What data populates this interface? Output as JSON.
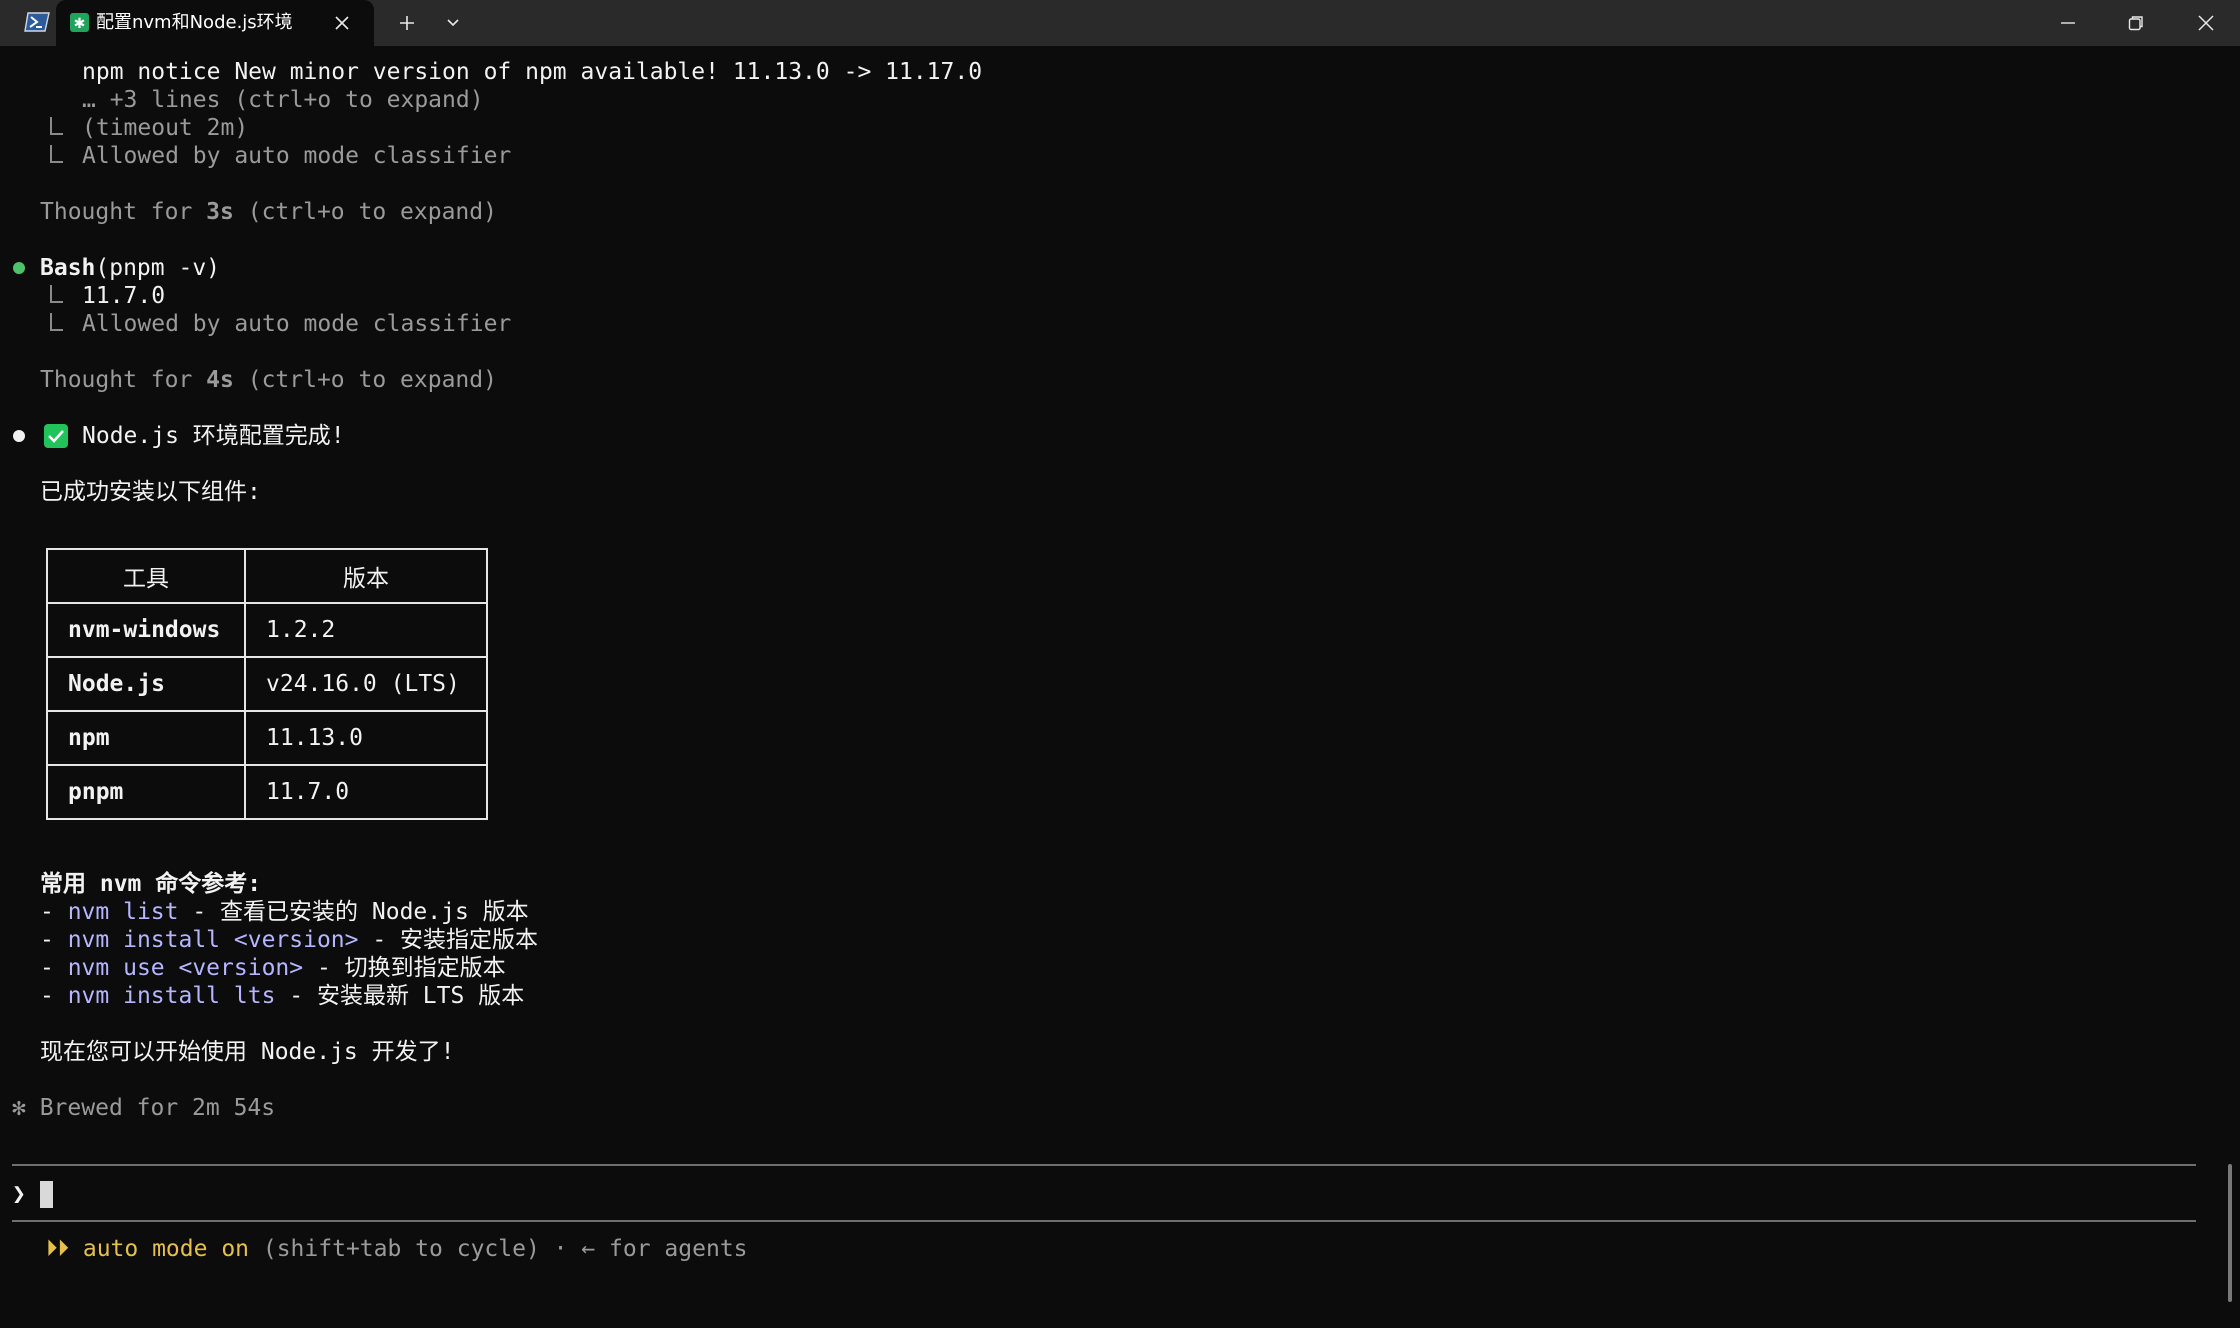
{
  "window": {
    "tab_title": "配置nvm和Node.js环境"
  },
  "terminal": {
    "npm_notice": "npm notice New minor version of npm available! 11.13.0 -> 11.17.0",
    "collapsed_lines": "… +3 lines (ctrl+o to expand)",
    "timeout": "(timeout 2m)",
    "allowed_1": "Allowed by auto mode classifier",
    "thought_1": {
      "prefix": "Thought for ",
      "time": "3s",
      "suffix": " (ctrl+o to expand)"
    },
    "bash_cmd": {
      "name": "Bash",
      "args": "(pnpm -v)"
    },
    "bash_output": "11.7.0",
    "allowed_2": "Allowed by auto mode classifier",
    "thought_2": {
      "prefix": "Thought for ",
      "time": "4s",
      "suffix": " (ctrl+o to expand)"
    },
    "done_title": "Node.js 环境配置完成!",
    "installed_intro": "已成功安装以下组件:",
    "table": {
      "headers": [
        "工具",
        "版本"
      ],
      "rows": [
        [
          "nvm-windows",
          "1.2.2"
        ],
        [
          "Node.js",
          "v24.16.0 (LTS)"
        ],
        [
          "npm",
          "11.13.0"
        ],
        [
          "pnpm",
          "11.7.0"
        ]
      ]
    },
    "commands_title": "常用 nvm 命令参考:",
    "commands": [
      {
        "dash": "- ",
        "cmd": "nvm list",
        "desc": " - 查看已安装的 Node.js 版本"
      },
      {
        "dash": "- ",
        "cmd": "nvm install <version>",
        "desc": " - 安装指定版本"
      },
      {
        "dash": "- ",
        "cmd": "nvm use <version>",
        "desc": " - 切换到指定版本"
      },
      {
        "dash": "- ",
        "cmd": "nvm install lts",
        "desc": " - 安装最新 LTS 版本"
      }
    ],
    "closing": "现在您可以开始使用 Node.js 开发了!",
    "brewed": {
      "symbol": "✻",
      "text": " Brewed for 2m 54s"
    }
  },
  "prompt": {
    "symbol": "❯",
    "input_value": ""
  },
  "status": {
    "arrows": "⏵⏵",
    "mode": " auto mode on",
    "hint": " (shift+tab to cycle) · ← for agents"
  },
  "colors": {
    "background": "#0c0c0c",
    "green_dot": "#4ec26b",
    "check_green": "#21c35a",
    "command_purple": "#b6b5ff",
    "mode_yellow": "#e5c04a"
  }
}
